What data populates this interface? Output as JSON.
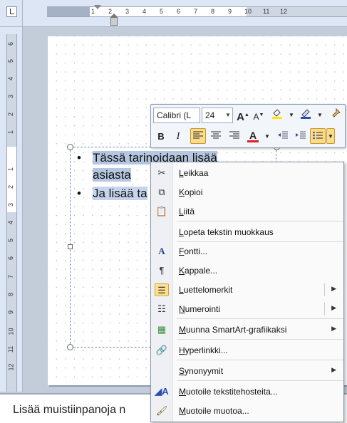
{
  "ruler": {
    "horizontal_numbers": [
      "1",
      "2",
      "3",
      "4",
      "5",
      "6",
      "7",
      "8",
      "9",
      "10",
      "11",
      "12"
    ],
    "vertical_numbers": [
      "6",
      "5",
      "4",
      "3",
      "2",
      "1",
      "1",
      "2",
      "3",
      "4",
      "5",
      "6",
      "7",
      "8",
      "9",
      "10",
      "11",
      "12"
    ]
  },
  "slide": {
    "bullet_1_selected": "Tässä tarinoidaan lisää",
    "bullet_1_line2": "asiasta",
    "bullet_2_visible": "Ja lisää ta"
  },
  "mini_toolbar": {
    "font_name": "Calibri (L",
    "font_size": "24",
    "grow_font_icon": "A",
    "shrink_font_icon": "A",
    "bold_label": "B",
    "italic_label": "I",
    "font_color_label": "A"
  },
  "context_menu": {
    "items": [
      {
        "label": "Leikkaa",
        "icon": "scissors-icon"
      },
      {
        "label": "Kopioi",
        "icon": "copy-icon"
      },
      {
        "label": "Liitä",
        "icon": "paste-icon"
      },
      {
        "label": "Lopeta tekstin muokkaus",
        "icon": ""
      },
      {
        "label": "Fontti...",
        "icon": "font-icon"
      },
      {
        "label": "Kappale...",
        "icon": "paragraph-icon"
      },
      {
        "label": "Luettelomerkit",
        "icon": "bullets-icon"
      },
      {
        "label": "Numerointi",
        "icon": "numbering-icon"
      },
      {
        "label": "Muunna SmartArt-grafiikaksi",
        "icon": "smartart-icon"
      },
      {
        "label": "Hyperlinkki...",
        "icon": "hyperlink-icon"
      },
      {
        "label": "Synonyymit",
        "icon": ""
      },
      {
        "label": "Muotoile tekstitehosteita...",
        "icon": "text-effects-icon"
      },
      {
        "label": "Muotoile muotoa...",
        "icon": "format-shape-icon"
      }
    ]
  },
  "notes": {
    "placeholder": "Lisää muistiinpanoja n"
  },
  "colors": {
    "selection": "#b5c7e0",
    "menu_highlight": "#fde18e",
    "font_color_red": "#e02020",
    "highlight_yellow": "#ffe800"
  }
}
